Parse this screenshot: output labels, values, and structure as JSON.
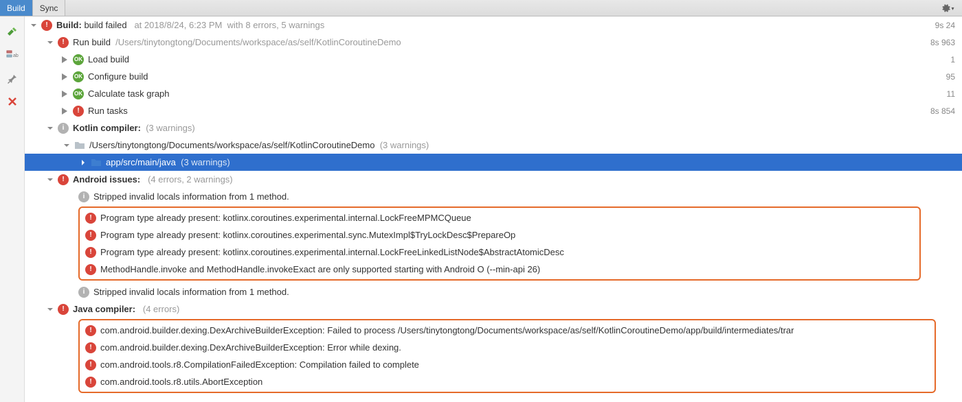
{
  "tabs": {
    "build": "Build",
    "sync": "Sync"
  },
  "build_header": {
    "label": "Build:",
    "status": "build failed",
    "timestamp": "at 2018/8/24, 6:23 PM",
    "summary": "with 8 errors, 5 warnings",
    "time": "9s 24"
  },
  "run_build": {
    "label": "Run build",
    "path": "/Users/tinytongtong/Documents/workspace/as/self/KotlinCoroutineDemo",
    "time": "8s 963"
  },
  "load_build": {
    "label": "Load build",
    "time": "1"
  },
  "configure_build": {
    "label": "Configure build",
    "time": "95"
  },
  "calculate": {
    "label": "Calculate task graph",
    "time": "11"
  },
  "run_tasks": {
    "label": "Run tasks",
    "time": "8s 854"
  },
  "kotlin": {
    "label": "Kotlin compiler:",
    "summary": "(3 warnings)",
    "path": "/Users/tinytongtong/Documents/workspace/as/self/KotlinCoroutineDemo",
    "path_summary": "(3 warnings)",
    "subpath": "app/src/main/java",
    "subpath_summary": "(3 warnings)"
  },
  "android": {
    "label": "Android issues:",
    "summary": "(4 errors, 2 warnings)",
    "stripped": "Stripped invalid locals information from 1 method.",
    "e1": "Program type already present: kotlinx.coroutines.experimental.internal.LockFreeMPMCQueue",
    "e2": "Program type already present: kotlinx.coroutines.experimental.sync.MutexImpl$TryLockDesc$PrepareOp",
    "e3": "Program type already present: kotlinx.coroutines.experimental.internal.LockFreeLinkedListNode$AbstractAtomicDesc",
    "e4": "MethodHandle.invoke and MethodHandle.invokeExact are only supported starting with Android O (--min-api 26)"
  },
  "java": {
    "label": "Java compiler:",
    "summary": "(4 errors)",
    "e1": "com.android.builder.dexing.DexArchiveBuilderException: Failed to process /Users/tinytongtong/Documents/workspace/as/self/KotlinCoroutineDemo/app/build/intermediates/trar",
    "e2": "com.android.builder.dexing.DexArchiveBuilderException: Error while dexing.",
    "e3": "com.android.tools.r8.CompilationFailedException: Compilation failed to complete",
    "e4": "com.android.tools.r8.utils.AbortException"
  }
}
